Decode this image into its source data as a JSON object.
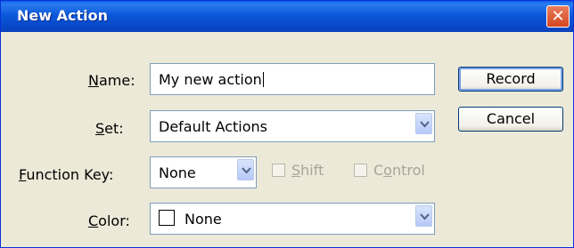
{
  "window": {
    "title": "New Action"
  },
  "titlebar": {
    "close_glyph": "✕"
  },
  "form": {
    "name": {
      "label_mnemonic": "N",
      "label_rest": "ame:",
      "value": "My new action"
    },
    "set": {
      "label_mnemonic": "S",
      "label_rest": "et:",
      "value": "Default Actions"
    },
    "function_key": {
      "label_mnemonic": "F",
      "label_rest": "unction Key:",
      "value": "None"
    },
    "shift": {
      "label_mnemonic": "S",
      "label_rest": "hift",
      "checked": false,
      "enabled": false
    },
    "control": {
      "label_pre": "C",
      "label_mnemonic": "o",
      "label_rest": "ntrol",
      "checked": false,
      "enabled": false
    },
    "color": {
      "label_mnemonic": "C",
      "label_rest": "olor:",
      "value": "None",
      "swatch_color": "#ffffff"
    }
  },
  "buttons": {
    "record": "Record",
    "cancel": "Cancel"
  },
  "icons": {
    "dropdown": "chevron-down-icon",
    "close": "close-icon"
  },
  "colors": {
    "titlebar": "#0a5fe8",
    "dialog_bg": "#ece9d8",
    "accent": "#7aa0e6"
  }
}
